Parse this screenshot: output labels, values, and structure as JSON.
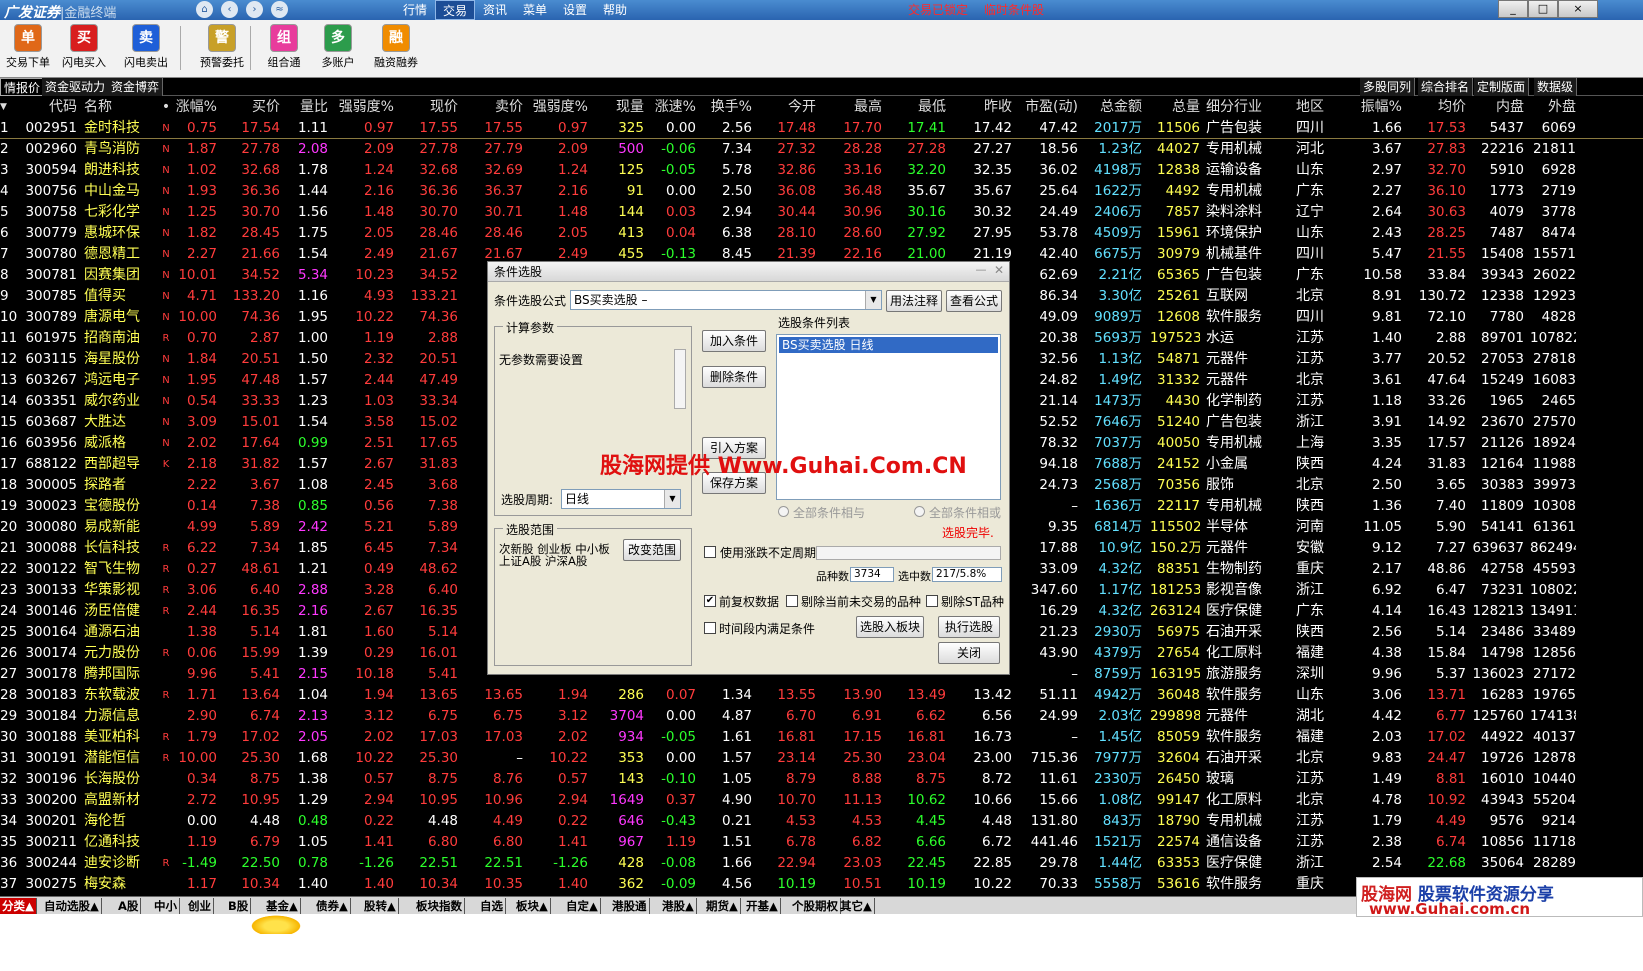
{
  "title": {
    "logo": "广发证券",
    "sep": "|",
    "product": "金融终端"
  },
  "top_menu": [
    "行情",
    "交易",
    "资讯",
    "菜单",
    "设置",
    "帮助"
  ],
  "top_menu_active": 1,
  "status": {
    "locked": "交易已锁定",
    "temp_cond": "临时条件股"
  },
  "window_buttons": [
    "_",
    "□",
    "×"
  ],
  "nav_icons": [
    "home-icon",
    "back-icon",
    "forward-icon",
    "collapse-icon"
  ],
  "toolbar": [
    {
      "label": "交易下单",
      "icon": "trade-order-icon",
      "color": "#e06818",
      "glyph": "单"
    },
    {
      "label": "闪电买入",
      "icon": "flash-buy-icon",
      "color": "#d81e1e",
      "glyph": "买"
    },
    {
      "label": "闪电卖出",
      "icon": "flash-sell-icon",
      "color": "#1e5fd8",
      "glyph": "卖"
    },
    {
      "label": "预警委托",
      "icon": "alert-entrust-icon",
      "color": "#c8a028",
      "glyph": "警"
    },
    {
      "label": "组合通",
      "icon": "portfolio-icon",
      "color": "#e83c9c",
      "glyph": "组"
    },
    {
      "label": "多账户",
      "icon": "multi-account-icon",
      "color": "#2c9c4c",
      "glyph": "多"
    },
    {
      "label": "融资融券",
      "icon": "margin-trading-icon",
      "color": "#f08c00",
      "glyph": "融"
    }
  ],
  "sub_tabs_left": [
    "情报价",
    "资金驱动力",
    "资金博弈"
  ],
  "sub_tabs_right": [
    "多股同列",
    "综合排名",
    "定制版面",
    "数据级"
  ],
  "columns": [
    "",
    "代码",
    "名称",
    "•",
    "涨幅%",
    "买价",
    "量比",
    "强弱度%",
    "现价",
    "卖价",
    "强弱度%",
    "现量",
    "涨速%",
    "换手%",
    "今开",
    "最高",
    "最低",
    "昨收",
    "市盈(动)",
    "总金额",
    "总量",
    "细分行业",
    "地区",
    "振幅%",
    "均价",
    "内盘",
    "外盘"
  ],
  "rows": [
    [
      "1",
      "002951",
      "金时科技",
      "N",
      "0.75",
      "17.54",
      "1.11",
      "0.97",
      "17.55",
      "17.55",
      "0.97",
      "325",
      "0.00",
      "2.56",
      "17.48",
      "17.70",
      "17.41",
      "17.42",
      "47.42",
      "2017万",
      "11506",
      "广告包装",
      "四川",
      "1.66",
      "17.53",
      "5437",
      "6069"
    ],
    [
      "2",
      "002960",
      "青鸟消防",
      "N",
      "1.87",
      "27.78",
      "2.08",
      "2.09",
      "27.78",
      "27.79",
      "2.09",
      "500",
      "-0.06",
      "7.34",
      "27.32",
      "28.28",
      "27.28",
      "27.27",
      "18.56",
      "1.23亿",
      "44027",
      "专用机械",
      "河北",
      "3.67",
      "27.83",
      "22216",
      "21811"
    ],
    [
      "3",
      "300594",
      "朗进科技",
      "N",
      "1.02",
      "32.68",
      "1.78",
      "1.24",
      "32.68",
      "32.69",
      "1.24",
      "125",
      "-0.05",
      "5.78",
      "32.86",
      "33.16",
      "32.20",
      "32.35",
      "36.02",
      "4198万",
      "12838",
      "运输设备",
      "山东",
      "2.97",
      "32.70",
      "5910",
      "6928"
    ],
    [
      "4",
      "300756",
      "中山金马",
      "N",
      "1.93",
      "36.36",
      "1.44",
      "2.16",
      "36.36",
      "36.37",
      "2.16",
      "91",
      "0.00",
      "2.50",
      "36.08",
      "36.48",
      "35.67",
      "35.67",
      "25.64",
      "1622万",
      "4492",
      "专用机械",
      "广东",
      "2.27",
      "36.10",
      "1773",
      "2719"
    ],
    [
      "5",
      "300758",
      "七彩化学",
      "N",
      "1.25",
      "30.70",
      "1.56",
      "1.48",
      "30.70",
      "30.71",
      "1.48",
      "144",
      "0.03",
      "2.94",
      "30.44",
      "30.96",
      "30.16",
      "30.32",
      "24.49",
      "2406万",
      "7857",
      "染料涂料",
      "辽宁",
      "2.64",
      "30.63",
      "4079",
      "3778"
    ],
    [
      "6",
      "300779",
      "惠城环保",
      "N",
      "1.82",
      "28.45",
      "1.75",
      "2.05",
      "28.46",
      "28.46",
      "2.05",
      "413",
      "0.04",
      "6.38",
      "28.10",
      "28.60",
      "27.92",
      "27.95",
      "53.78",
      "4509万",
      "15961",
      "环境保护",
      "山东",
      "2.43",
      "28.25",
      "7487",
      "8474"
    ],
    [
      "7",
      "300780",
      "德恩精工",
      "N",
      "2.27",
      "21.66",
      "1.54",
      "2.49",
      "21.67",
      "21.67",
      "2.49",
      "455",
      "-0.13",
      "8.45",
      "21.39",
      "22.16",
      "21.00",
      "21.19",
      "42.40",
      "6675万",
      "30979",
      "机械基件",
      "四川",
      "5.47",
      "21.55",
      "15408",
      "15571"
    ],
    [
      "8",
      "300781",
      "因赛集团",
      "N",
      "10.01",
      "34.52",
      "5.34",
      "10.23",
      "34.52",
      "",
      "",
      "",
      "",
      "",
      "",
      "",
      "",
      "",
      "62.69",
      "2.21亿",
      "65365",
      "广告包装",
      "广东",
      "10.58",
      "33.84",
      "39343",
      "26022"
    ],
    [
      "9",
      "300785",
      "值得买",
      "N",
      "4.71",
      "133.20",
      "1.16",
      "4.93",
      "133.21",
      "",
      "",
      "",
      "",
      "",
      "",
      "",
      "",
      "",
      "86.34",
      "3.30亿",
      "25261",
      "互联网",
      "北京",
      "8.91",
      "130.72",
      "12338",
      "12923"
    ],
    [
      "10",
      "300789",
      "唐源电气",
      "N",
      "10.00",
      "74.36",
      "1.95",
      "10.22",
      "74.36",
      "",
      "",
      "",
      "",
      "",
      "",
      "",
      "",
      "",
      "49.09",
      "9089万",
      "12608",
      "软件服务",
      "四川",
      "9.81",
      "72.10",
      "7780",
      "4828"
    ],
    [
      "11",
      "601975",
      "招商南油",
      "R",
      "0.70",
      "2.87",
      "1.00",
      "1.19",
      "2.88",
      "",
      "",
      "",
      "",
      "",
      "",
      "",
      "",
      "",
      "20.38",
      "5693万",
      "197523",
      "水运",
      "江苏",
      "1.40",
      "2.88",
      "89701",
      "107822"
    ],
    [
      "12",
      "603115",
      "海星股份",
      "N",
      "1.84",
      "20.51",
      "1.50",
      "2.32",
      "20.51",
      "",
      "",
      "",
      "",
      "",
      "",
      "",
      "",
      "",
      "32.56",
      "1.13亿",
      "54871",
      "元器件",
      "江苏",
      "3.77",
      "20.52",
      "27053",
      "27818"
    ],
    [
      "13",
      "603267",
      "鸿远电子",
      "N",
      "1.95",
      "47.48",
      "1.57",
      "2.44",
      "47.49",
      "",
      "",
      "",
      "",
      "",
      "",
      "",
      "",
      "",
      "24.82",
      "1.49亿",
      "31332",
      "元器件",
      "北京",
      "3.61",
      "47.64",
      "15249",
      "16083"
    ],
    [
      "14",
      "603351",
      "威尔药业",
      "N",
      "0.54",
      "33.33",
      "1.23",
      "1.03",
      "33.34",
      "",
      "",
      "",
      "",
      "",
      "",
      "",
      "",
      "",
      "21.14",
      "1473万",
      "4430",
      "化学制药",
      "江苏",
      "1.18",
      "33.26",
      "1965",
      "2465"
    ],
    [
      "15",
      "603687",
      "大胜达",
      "N",
      "3.09",
      "15.01",
      "1.54",
      "3.58",
      "15.02",
      "",
      "",
      "",
      "",
      "",
      "",
      "",
      "",
      "",
      "52.52",
      "7646万",
      "51240",
      "广告包装",
      "浙江",
      "3.91",
      "14.92",
      "23670",
      "27570"
    ],
    [
      "16",
      "603956",
      "威派格",
      "N",
      "2.02",
      "17.64",
      "0.99",
      "2.51",
      "17.65",
      "",
      "",
      "",
      "",
      "",
      "",
      "",
      "",
      "",
      "78.32",
      "7037万",
      "40050",
      "专用机械",
      "上海",
      "3.35",
      "17.57",
      "21126",
      "18924"
    ],
    [
      "17",
      "688122",
      "西部超导",
      "K",
      "2.18",
      "31.82",
      "1.57",
      "2.67",
      "31.83",
      "",
      "",
      "",
      "",
      "",
      "",
      "",
      "",
      "",
      "94.18",
      "7688万",
      "24152",
      "小金属",
      "陕西",
      "4.24",
      "31.83",
      "12164",
      "11988"
    ],
    [
      "18",
      "300005",
      "探路者",
      "",
      "2.22",
      "3.67",
      "1.08",
      "2.45",
      "3.68",
      "",
      "",
      "",
      "",
      "",
      "",
      "",
      "",
      "",
      "24.73",
      "2568万",
      "70356",
      "服饰",
      "北京",
      "2.50",
      "3.65",
      "30383",
      "39973"
    ],
    [
      "19",
      "300023",
      "宝德股份",
      "",
      "0.14",
      "7.38",
      "0.85",
      "0.56",
      "7.38",
      "",
      "",
      "",
      "",
      "",
      "",
      "",
      "",
      "",
      "–",
      "1636万",
      "22117",
      "专用机械",
      "陕西",
      "1.36",
      "7.40",
      "11809",
      "10308"
    ],
    [
      "20",
      "300080",
      "易成新能",
      "",
      "4.99",
      "5.89",
      "2.42",
      "5.21",
      "5.89",
      "",
      "",
      "",
      "",
      "",
      "",
      "",
      "",
      "",
      "9.35",
      "6814万",
      "115502",
      "半导体",
      "河南",
      "11.05",
      "5.90",
      "54141",
      "61361"
    ],
    [
      "21",
      "300088",
      "长信科技",
      "R",
      "6.22",
      "7.34",
      "1.85",
      "6.45",
      "7.34",
      "",
      "",
      "",
      "",
      "",
      "",
      "",
      "",
      "",
      "17.88",
      "10.9亿",
      "150.2万",
      "元器件",
      "安徽",
      "9.12",
      "7.27",
      "639637",
      "862494"
    ],
    [
      "22",
      "300122",
      "智飞生物",
      "R",
      "0.27",
      "48.61",
      "1.21",
      "0.49",
      "48.62",
      "",
      "",
      "",
      "",
      "",
      "",
      "",
      "",
      "",
      "33.09",
      "4.32亿",
      "88351",
      "生物制药",
      "重庆",
      "2.17",
      "48.86",
      "42758",
      "45593"
    ],
    [
      "23",
      "300133",
      "华策影视",
      "R",
      "3.06",
      "6.40",
      "2.88",
      "3.28",
      "6.40",
      "",
      "",
      "",
      "",
      "",
      "",
      "",
      "",
      "",
      "347.60",
      "1.17亿",
      "181253",
      "影视音像",
      "浙江",
      "6.92",
      "6.47",
      "73231",
      "108022"
    ],
    [
      "24",
      "300146",
      "汤臣倍健",
      "R",
      "2.44",
      "16.35",
      "2.16",
      "2.67",
      "16.35",
      "",
      "",
      "",
      "",
      "",
      "",
      "",
      "",
      "",
      "16.29",
      "4.32亿",
      "263124",
      "医疗保健",
      "广东",
      "4.14",
      "16.43",
      "128213",
      "134911"
    ],
    [
      "25",
      "300164",
      "通源石油",
      "",
      "1.38",
      "5.14",
      "1.81",
      "1.60",
      "5.14",
      "",
      "",
      "",
      "",
      "",
      "",
      "",
      "",
      "",
      "21.23",
      "2930万",
      "56975",
      "石油开采",
      "陕西",
      "2.56",
      "5.14",
      "23486",
      "33489"
    ],
    [
      "26",
      "300174",
      "元力股份",
      "R",
      "0.06",
      "15.99",
      "1.39",
      "0.29",
      "16.01",
      "",
      "",
      "",
      "",
      "",
      "",
      "",
      "",
      "",
      "43.90",
      "4379万",
      "27654",
      "化工原料",
      "福建",
      "4.38",
      "15.84",
      "14798",
      "12856"
    ],
    [
      "27",
      "300178",
      "腾邦国际",
      "",
      "9.96",
      "5.41",
      "2.15",
      "10.18",
      "5.41",
      "",
      "",
      "",
      "",
      "",
      "",
      "",
      "",
      "",
      "–",
      "8759万",
      "163195",
      "旅游服务",
      "深圳",
      "9.96",
      "5.37",
      "136023",
      "27172"
    ],
    [
      "28",
      "300183",
      "东软载波",
      "R",
      "1.71",
      "13.64",
      "1.04",
      "1.94",
      "13.65",
      "13.65",
      "1.94",
      "286",
      "0.07",
      "1.34",
      "13.55",
      "13.90",
      "13.49",
      "13.42",
      "51.11",
      "4942万",
      "36048",
      "软件服务",
      "山东",
      "3.06",
      "13.71",
      "16283",
      "19765"
    ],
    [
      "29",
      "300184",
      "力源信息",
      "",
      "2.90",
      "6.74",
      "2.13",
      "3.12",
      "6.75",
      "6.75",
      "3.12",
      "3704",
      "0.00",
      "4.87",
      "6.70",
      "6.91",
      "6.62",
      "6.56",
      "24.99",
      "2.03亿",
      "299898",
      "元器件",
      "湖北",
      "4.42",
      "6.77",
      "125760",
      "174138"
    ],
    [
      "30",
      "300188",
      "美亚柏科",
      "R",
      "1.79",
      "17.02",
      "2.05",
      "2.02",
      "17.03",
      "17.03",
      "2.02",
      "934",
      "-0.05",
      "1.61",
      "16.81",
      "17.15",
      "16.81",
      "16.73",
      "–",
      "1.45亿",
      "85059",
      "软件服务",
      "福建",
      "2.03",
      "17.02",
      "44922",
      "40137"
    ],
    [
      "31",
      "300191",
      "潜能恒信",
      "R",
      "10.00",
      "25.30",
      "1.68",
      "10.22",
      "25.30",
      "–",
      "10.22",
      "353",
      "0.00",
      "1.57",
      "23.14",
      "25.30",
      "23.04",
      "23.00",
      "715.36",
      "7977万",
      "32604",
      "石油开采",
      "北京",
      "9.83",
      "24.47",
      "19726",
      "12878"
    ],
    [
      "32",
      "300196",
      "长海股份",
      "",
      "0.34",
      "8.75",
      "1.38",
      "0.57",
      "8.75",
      "8.76",
      "0.57",
      "143",
      "-0.10",
      "1.05",
      "8.79",
      "8.88",
      "8.75",
      "8.72",
      "11.61",
      "2330万",
      "26450",
      "玻璃",
      "江苏",
      "1.49",
      "8.81",
      "16010",
      "10440"
    ],
    [
      "33",
      "300200",
      "高盟新材",
      "",
      "2.72",
      "10.95",
      "1.29",
      "2.94",
      "10.95",
      "10.96",
      "2.94",
      "1649",
      "0.37",
      "4.90",
      "10.70",
      "11.13",
      "10.62",
      "10.66",
      "15.66",
      "1.08亿",
      "99147",
      "化工原料",
      "北京",
      "4.78",
      "10.92",
      "43943",
      "55204"
    ],
    [
      "34",
      "300201",
      "海伦哲",
      "",
      "0.00",
      "4.48",
      "0.48",
      "0.22",
      "4.48",
      "4.49",
      "0.22",
      "646",
      "-0.43",
      "0.21",
      "4.53",
      "4.53",
      "4.45",
      "4.48",
      "131.80",
      "843万",
      "18790",
      "专用机械",
      "江苏",
      "1.79",
      "4.49",
      "9576",
      "9214"
    ],
    [
      "35",
      "300211",
      "亿通科技",
      "",
      "1.19",
      "6.79",
      "1.05",
      "1.41",
      "6.80",
      "6.80",
      "1.41",
      "967",
      "1.19",
      "1.51",
      "6.78",
      "6.82",
      "6.66",
      "6.72",
      "441.46",
      "1521万",
      "22574",
      "通信设备",
      "江苏",
      "2.38",
      "6.74",
      "10856",
      "11718"
    ],
    [
      "36",
      "300244",
      "迪安诊断",
      "R",
      "-1.49",
      "22.50",
      "0.78",
      "-1.26",
      "22.51",
      "22.51",
      "-1.26",
      "428",
      "-0.08",
      "1.66",
      "22.94",
      "23.03",
      "22.45",
      "22.85",
      "29.78",
      "1.44亿",
      "63353",
      "医疗保健",
      "浙江",
      "2.54",
      "22.68",
      "35064",
      "28289"
    ],
    [
      "37",
      "300275",
      "梅安森",
      "",
      "1.17",
      "10.34",
      "1.40",
      "1.40",
      "10.34",
      "10.35",
      "1.40",
      "362",
      "-0.09",
      "4.56",
      "10.19",
      "10.51",
      "10.19",
      "10.22",
      "70.33",
      "5558万",
      "53616",
      "软件服务",
      "重庆",
      "",
      "",
      "",
      ""
    ]
  ],
  "bottom_tabs": [
    "分类▲",
    "自动选股▲",
    "A股",
    "中小",
    "创业",
    "B股",
    "基金▲",
    "债券▲",
    "股转▲",
    "板块指数",
    "自选",
    "板块▲",
    "自定▲",
    "港股通",
    "港股▲",
    "期货▲",
    "开基▲",
    "个股期权",
    "其它▲"
  ],
  "bottom_tabs_active": 0,
  "dialog": {
    "title": "条件选股",
    "formula_label": "条件选股公式",
    "formula_value": "BS买卖选股  –",
    "btn_usage": "用法注释",
    "btn_view": "查看公式",
    "calc_group": "计算参数",
    "no_params": "无参数需要设置",
    "period_label": "选股周期:",
    "period_value": "日线",
    "range_group": "选股范围",
    "range_text1": "次新股 创业板 中小板",
    "range_text2": "上证A股 沪深A股",
    "btn_change_range": "改变范围",
    "btn_add": "加入条件",
    "btn_delete": "删除条件",
    "btn_import": "引入方案",
    "btn_save": "保存方案",
    "list_title": "选股条件列表",
    "list_item": "BS买卖选股   日线",
    "radio_and": "全部条件相与",
    "radio_or": "全部条件相或",
    "done_text": "选股完毕.",
    "chk_use_limit": "使用涨跌不定周期",
    "count_label": "品种数",
    "count_value": "3734",
    "selected_label": "选中数",
    "selected_value": "217/5.8%",
    "chk_prev_adjust": "前复权数据",
    "chk_exclude_untraded": "剔除当前未交易的品种",
    "chk_exclude_st": "剔除ST品种",
    "chk_period_meet": "时间段内满足条件",
    "btn_to_block": "选股入板块",
    "btn_execute": "执行选股",
    "btn_close": "关闭",
    "watermark": "股海网提供 Www.Guhai.Com.CN"
  },
  "watermark_logo": {
    "line1a": "股海网",
    "line1b": "股票软件资源分享",
    "line2": "www.Guhai.com.cn"
  },
  "colors": {
    "up": "#ff3c3c",
    "down": "#2cff2c",
    "name": "#ffff54",
    "dialog_bg": "#ece9d8",
    "selection": "#316ac5"
  }
}
